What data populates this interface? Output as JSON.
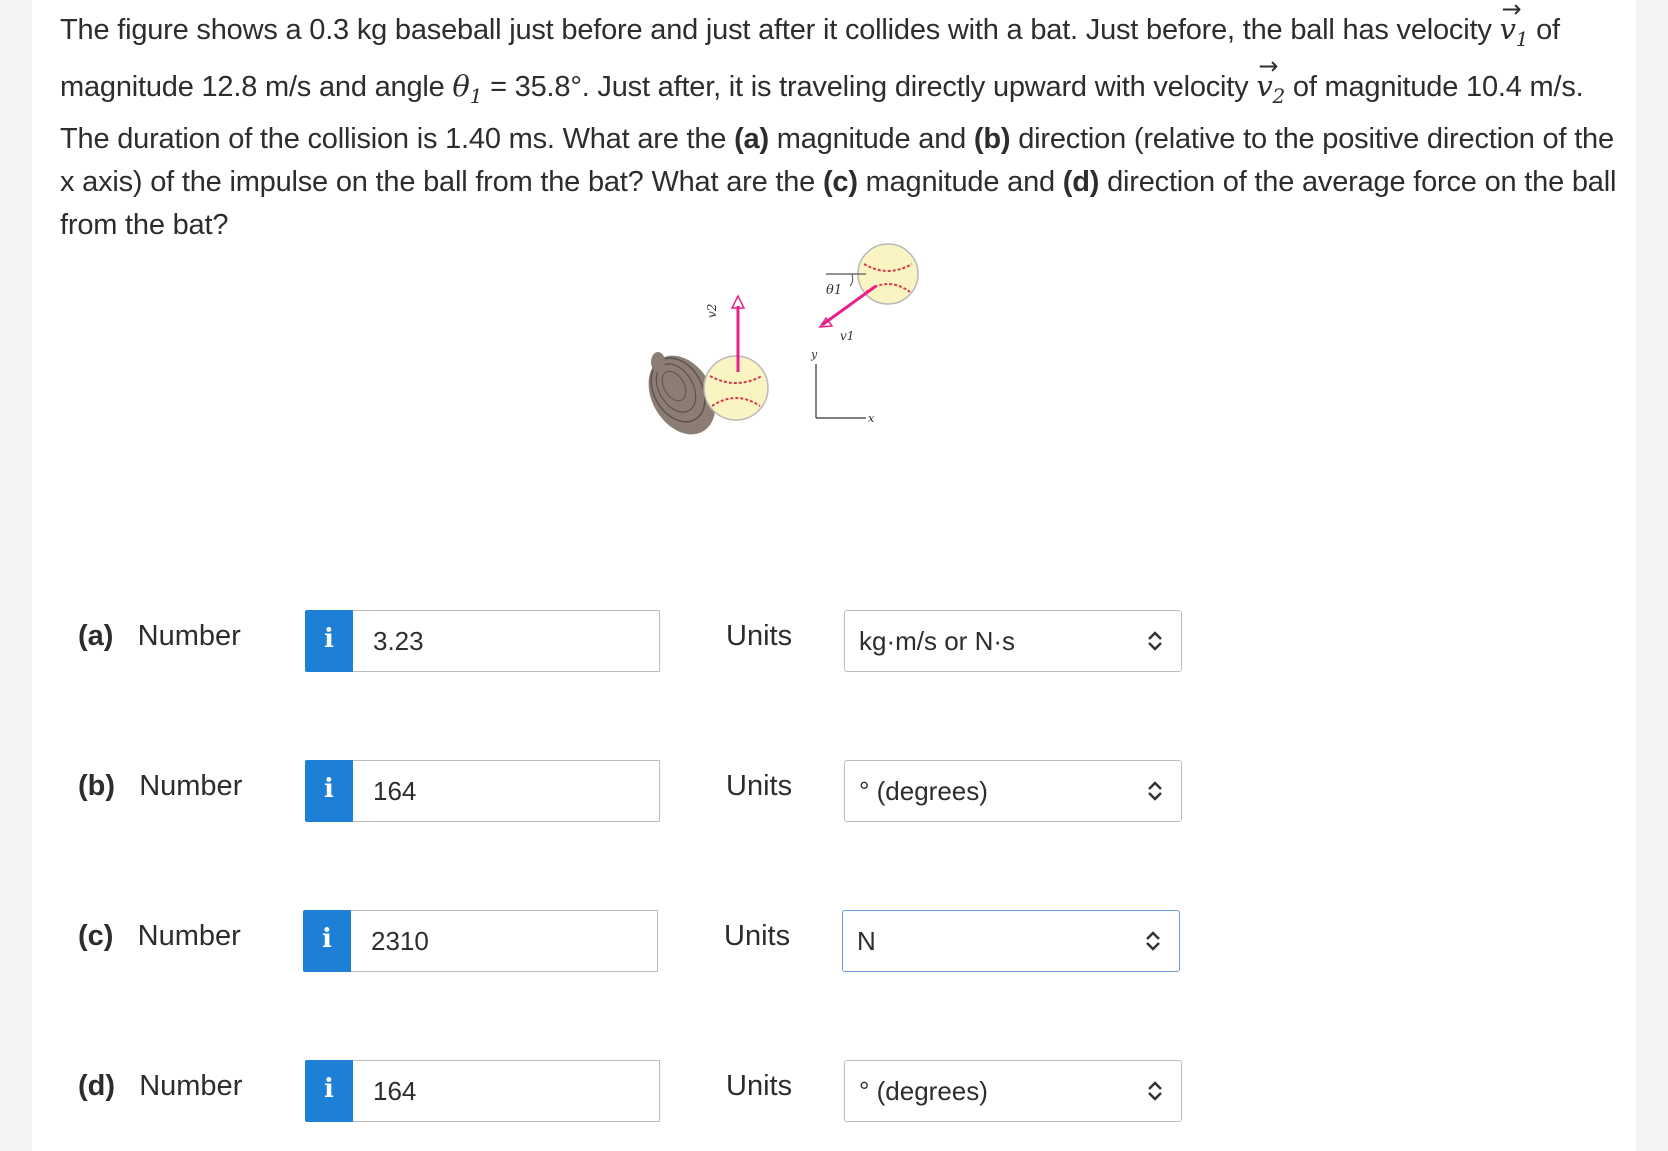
{
  "problem": {
    "intro": "The figure shows a 0.3 kg baseball just before and just after it collides with a bat. Just before, the ball has velocity",
    "v1_symbol": "v",
    "v1_sub": "1",
    "mid1": "of magnitude 12.8 m/s and angle",
    "theta_symbol": "θ",
    "theta_sub": "1",
    "mid2": "= 35.8°. Just after, it is traveling directly upward with velocity",
    "v2_symbol": "v",
    "v2_sub": "2",
    "mid3": "of magnitude 10.4 m/s. The duration of the collision is 1.40 ms. What are the",
    "part_a": "(a)",
    "text_a": "magnitude and",
    "part_b": "(b)",
    "text_b": "direction (relative to the positive direction of the x axis) of the impulse on the ball from the bat? What are the",
    "part_c": "(c)",
    "text_c": "magnitude and",
    "part_d": "(d)",
    "text_d": "direction of the average force on the ball from the bat?"
  },
  "figure": {
    "theta_label": "θ1",
    "v1_label": "v1",
    "v2_label": "v2",
    "y_label": "y",
    "x_label": "x"
  },
  "answers": [
    {
      "part": "(a)",
      "label": "Number",
      "value": "3.23",
      "units_label": "Units",
      "unit": "kg·m/s or N·s"
    },
    {
      "part": "(b)",
      "label": "Number",
      "value": "164",
      "units_label": "Units",
      "unit": "° (degrees)"
    },
    {
      "part": "(c)",
      "label": "Number",
      "value": "2310",
      "units_label": "Units",
      "unit": "N"
    },
    {
      "part": "(d)",
      "label": "Number",
      "value": "164",
      "units_label": "Units",
      "unit": "° (degrees)"
    }
  ],
  "info_glyph": "i",
  "colors": {
    "info_button": "#1e7fd6",
    "velocity_vector": "#e8208c",
    "focused_border": "#6a9ad4"
  },
  "icons": {
    "info": "info-icon",
    "select": "chevron-up-down-icon"
  }
}
